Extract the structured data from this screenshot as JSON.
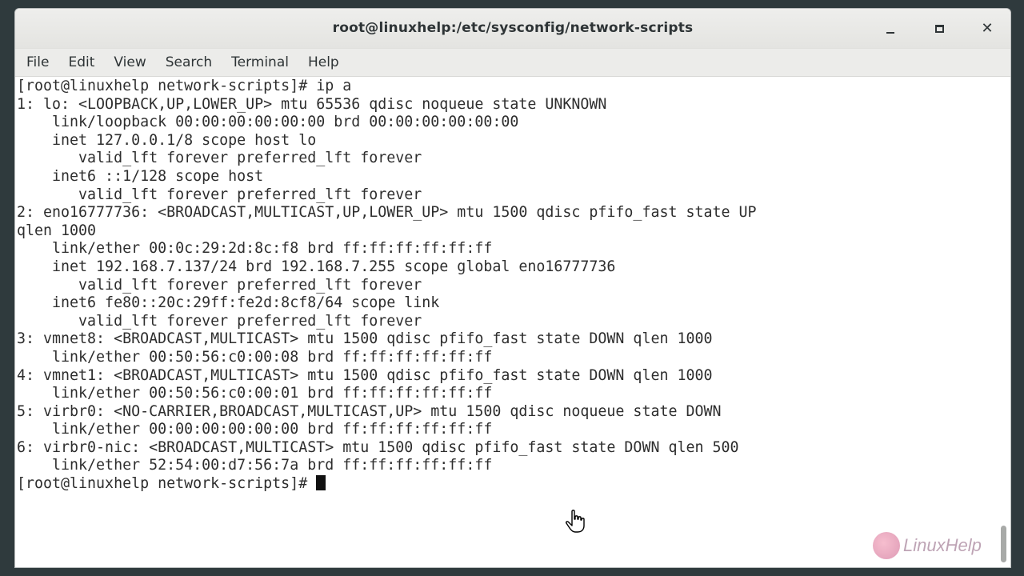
{
  "window": {
    "title": "root@linuxhelp:/etc/sysconfig/network-scripts",
    "minimize_label": "minimize",
    "maximize_label": "maximize",
    "close_label": "✕"
  },
  "menubar": {
    "items": [
      "File",
      "Edit",
      "View",
      "Search",
      "Terminal",
      "Help"
    ]
  },
  "terminal": {
    "lines": [
      "[root@linuxhelp network-scripts]# ip a",
      "1: lo: <LOOPBACK,UP,LOWER_UP> mtu 65536 qdisc noqueue state UNKNOWN",
      "    link/loopback 00:00:00:00:00:00 brd 00:00:00:00:00:00",
      "    inet 127.0.0.1/8 scope host lo",
      "       valid_lft forever preferred_lft forever",
      "    inet6 ::1/128 scope host",
      "       valid_lft forever preferred_lft forever",
      "2: eno16777736: <BROADCAST,MULTICAST,UP,LOWER_UP> mtu 1500 qdisc pfifo_fast state UP",
      "qlen 1000",
      "    link/ether 00:0c:29:2d:8c:f8 brd ff:ff:ff:ff:ff:ff",
      "    inet 192.168.7.137/24 brd 192.168.7.255 scope global eno16777736",
      "       valid_lft forever preferred_lft forever",
      "    inet6 fe80::20c:29ff:fe2d:8cf8/64 scope link",
      "       valid_lft forever preferred_lft forever",
      "3: vmnet8: <BROADCAST,MULTICAST> mtu 1500 qdisc pfifo_fast state DOWN qlen 1000",
      "    link/ether 00:50:56:c0:00:08 brd ff:ff:ff:ff:ff:ff",
      "4: vmnet1: <BROADCAST,MULTICAST> mtu 1500 qdisc pfifo_fast state DOWN qlen 1000",
      "    link/ether 00:50:56:c0:00:01 brd ff:ff:ff:ff:ff:ff",
      "5: virbr0: <NO-CARRIER,BROADCAST,MULTICAST,UP> mtu 1500 qdisc noqueue state DOWN",
      "    link/ether 00:00:00:00:00:00 brd ff:ff:ff:ff:ff:ff",
      "6: virbr0-nic: <BROADCAST,MULTICAST> mtu 1500 qdisc pfifo_fast state DOWN qlen 500",
      "    link/ether 52:54:00:d7:56:7a brd ff:ff:ff:ff:ff:ff"
    ],
    "prompt": "[root@linuxhelp network-scripts]# "
  },
  "watermark": {
    "text": "LinuxHelp",
    "icon": "linuxhelp-logo-icon"
  },
  "colors": {
    "terminal_text": "#2e2e2e",
    "titlebar": "#e8e8e5",
    "desktop": "#2f3a3d"
  }
}
